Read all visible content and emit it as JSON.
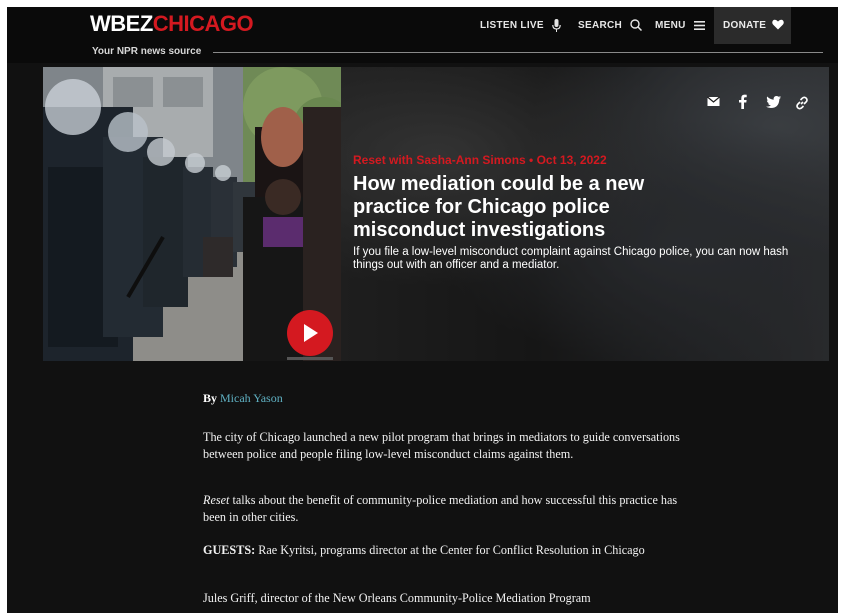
{
  "header": {
    "logo_wbez": "WBEZ",
    "logo_chicago": "CHICAGO",
    "tagline": "Your NPR news source",
    "nav": {
      "listen_live": "LISTEN LIVE",
      "search": "SEARCH",
      "menu": "MENU",
      "donate": "DONATE"
    }
  },
  "hero": {
    "kicker": "Reset with Sasha-Ann Simons • Oct 13, 2022",
    "headline": "How mediation could be a new practice for Chicago police misconduct investigations",
    "dek": "If you file a low-level misconduct complaint against Chicago police, you can now hash things out with an officer and a mediator.",
    "share_icons": [
      "email-icon",
      "facebook-icon",
      "twitter-icon",
      "link-icon"
    ]
  },
  "article": {
    "by_label": "By",
    "author": "Micah Yason",
    "p1": "The city of Chicago launched a new pilot program that brings in mediators to guide conversations between police and people filing low-level misconduct claims against them.",
    "p2_show": "Reset",
    "p2_rest": " talks about the benefit of community-police mediation and how successful this practice has been in other cities.",
    "p3_label": "GUESTS:",
    "p3_rest": " Rae Kyritsi, programs director at the Center for Conflict Resolution in Chicago",
    "p4": "Jules Griff, director of the New Orleans Community-Police Mediation Program"
  },
  "colors": {
    "brand_red": "#d41920",
    "link_teal": "#5fb0c2",
    "background": "#111111"
  }
}
